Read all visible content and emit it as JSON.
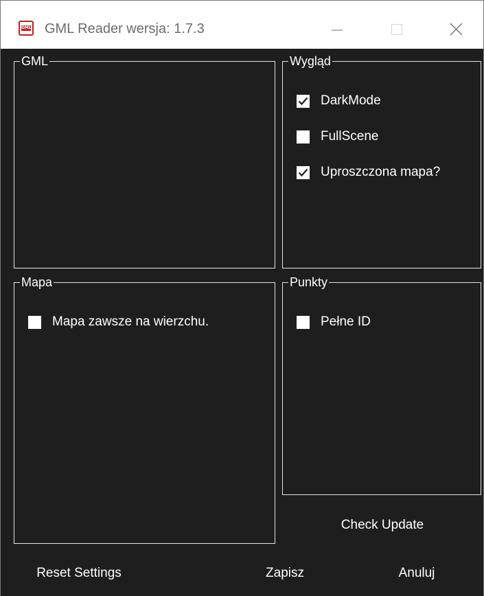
{
  "window": {
    "icon_text": "GML",
    "title": "GML Reader wersja: 1.7.3"
  },
  "groups": {
    "gml": {
      "title": "GML"
    },
    "wyglad": {
      "title": "Wygląd",
      "options": [
        {
          "label": "DarkMode",
          "checked": true
        },
        {
          "label": "FullScene",
          "checked": false
        },
        {
          "label": "Uproszczona mapa?",
          "checked": true
        }
      ]
    },
    "mapa": {
      "title": "Mapa",
      "options": [
        {
          "label": "Mapa zawsze na wierzchu.",
          "checked": false
        }
      ]
    },
    "punkty": {
      "title": "Punkty",
      "options": [
        {
          "label": "Pełne ID",
          "checked": false
        }
      ]
    }
  },
  "buttons": {
    "check_update": "Check Update",
    "reset_settings": "Reset Settings",
    "save": "Zapisz",
    "cancel": "Anuluj"
  },
  "colors": {
    "background": "#1e1e1e",
    "text": "#ffffff",
    "titlebar": "#ffffff",
    "icon_accent": "#c41e1e"
  }
}
